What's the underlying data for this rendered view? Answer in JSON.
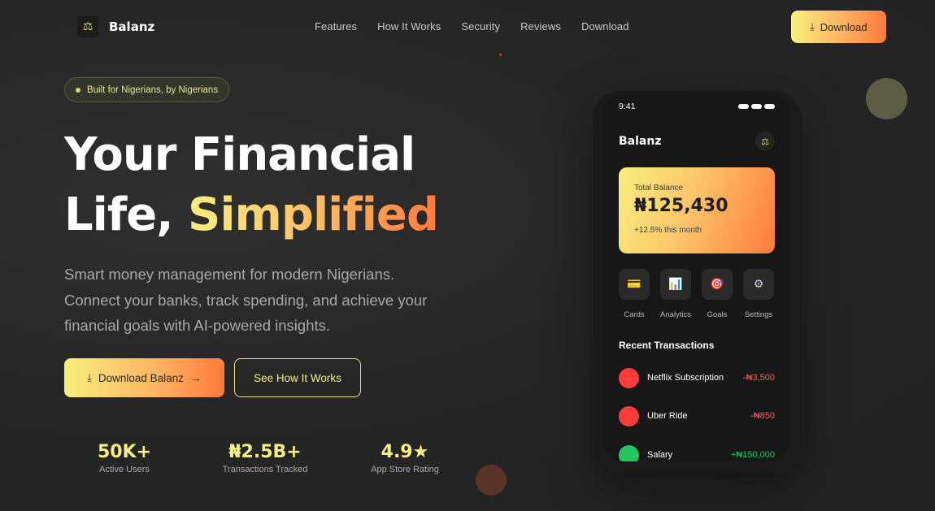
{
  "brand": {
    "name": "Balanz",
    "logo_icon": "scales-icon"
  },
  "nav": {
    "links": [
      "Features",
      "How It Works",
      "Security",
      "Reviews",
      "Download"
    ],
    "cta_label": "Download"
  },
  "hero": {
    "badge": "Built for Nigerians, by Nigerians",
    "headline_line1": "Your Financial",
    "headline_line2_plain": "Life,",
    "headline_line2_highlight": "Simplified",
    "subtext": "Smart money management for modern Nigerians. Connect your banks, track spending, and achieve your financial goals with AI-powered insights.",
    "primary_button": "Download Balanz",
    "secondary_button": "See How It Works"
  },
  "stats": [
    {
      "value": "50K+",
      "label": "Active Users"
    },
    {
      "value": "₦2.5B+",
      "label": "Transactions Tracked"
    },
    {
      "value": "4.9★",
      "label": "App Store Rating"
    }
  ],
  "phone": {
    "time": "9:41",
    "app_title": "Balanz",
    "balance": {
      "label": "Total Balance",
      "amount": "₦125,430",
      "change": "+12.5% this month"
    },
    "quick_actions": [
      {
        "label": "Cards",
        "icon": "credit-card-icon",
        "glyph": "💳"
      },
      {
        "label": "Analytics",
        "icon": "chart-icon",
        "glyph": "📊"
      },
      {
        "label": "Goals",
        "icon": "target-icon",
        "glyph": "🎯"
      },
      {
        "label": "Settings",
        "icon": "gear-icon",
        "glyph": "⚙"
      }
    ],
    "recent_title": "Recent Transactions",
    "transactions": [
      {
        "name": "Netflix Subscription",
        "amount": "-₦3,500",
        "color": "#ff3b3b",
        "amount_color": "#ff5c5c"
      },
      {
        "name": "Uber Ride",
        "amount": "-₦850",
        "color": "#ff3b3b",
        "amount_color": "#ff5c5c"
      },
      {
        "name": "Salary",
        "amount": "+₦150,000",
        "color": "#22c55e",
        "amount_color": "#22c55e"
      }
    ]
  },
  "colors": {
    "accent_yellow": "#f9f07c",
    "accent_orange": "#ff7a3d",
    "background": "#262626"
  }
}
